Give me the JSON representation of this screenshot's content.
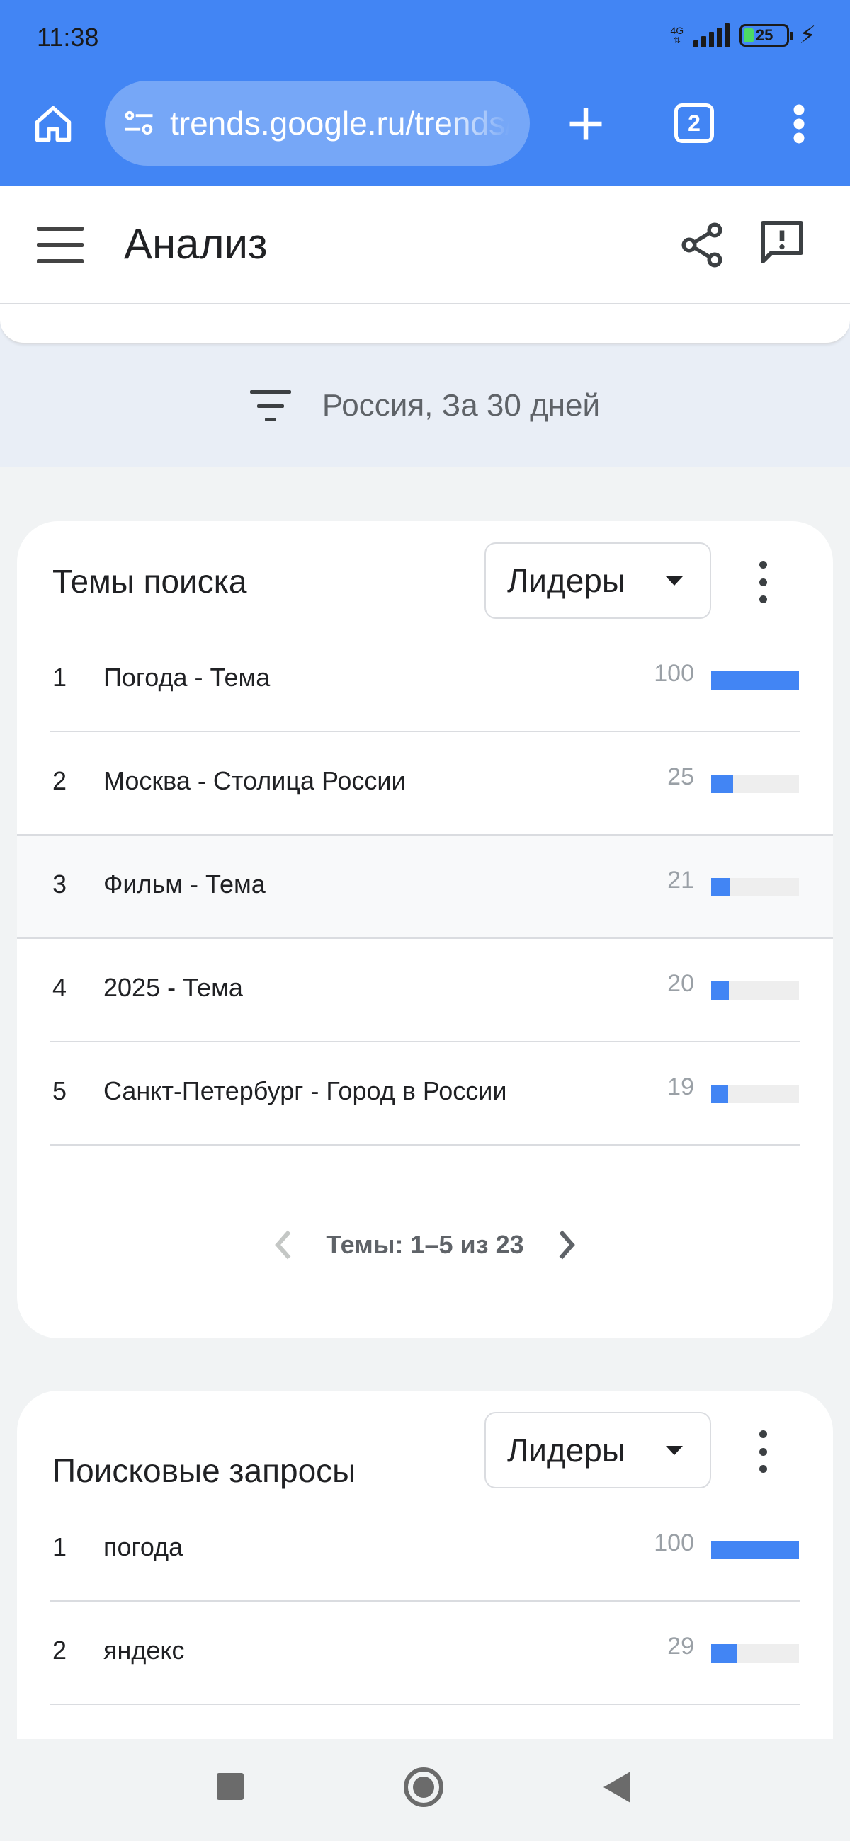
{
  "status_bar": {
    "time": "11:38",
    "network_label": "4G",
    "battery_percent": "25"
  },
  "browser": {
    "url": "trends.google.ru/trends/explore",
    "tab_count": "2"
  },
  "app_header": {
    "title": "Анализ"
  },
  "filter": {
    "text": "Россия, За 30 дней"
  },
  "topics_card": {
    "title": "Темы поиска",
    "dropdown_value": "Лидеры",
    "rows": [
      {
        "rank": "1",
        "label": "Погода - Тема",
        "value": 100
      },
      {
        "rank": "2",
        "label": "Москва - Столица России",
        "value": 25
      },
      {
        "rank": "3",
        "label": "Фильм - Тема",
        "value": 21
      },
      {
        "rank": "4",
        "label": "2025 - Тема",
        "value": 20
      },
      {
        "rank": "5",
        "label": "Санкт-Петербург - Город в России",
        "value": 19
      }
    ],
    "pager_text": "Темы: 1–5 из 23"
  },
  "queries_card": {
    "title": "Поисковые запросы",
    "dropdown_value": "Лидеры",
    "rows": [
      {
        "rank": "1",
        "label": "погода",
        "value": 100
      },
      {
        "rank": "2",
        "label": "яндекс",
        "value": 29
      }
    ]
  },
  "colors": {
    "accent": "#4285f4",
    "bar_track": "#eeeeee"
  }
}
